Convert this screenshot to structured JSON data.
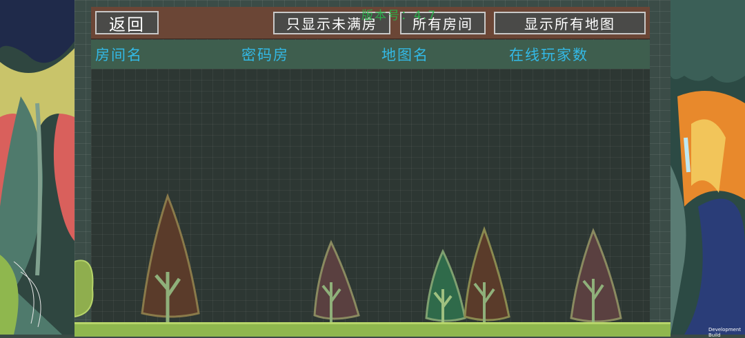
{
  "topbar": {
    "back_label": "返回",
    "filter_not_full_label": "只显示未满房",
    "all_rooms_label": "所有房间",
    "show_all_maps_label": "显示所有地图",
    "version_text": "版本号：4.7"
  },
  "table": {
    "columns": [
      "房间名",
      "密码房",
      "地图名",
      "在线玩家数"
    ],
    "rows": []
  },
  "footer": {
    "dev_build_text": "Development Build"
  },
  "colors": {
    "topbar": "#6b4636",
    "header_row": "#3e5e4e",
    "column_text": "#33b9e6",
    "version_text": "#28b84a",
    "list_background": "#2d3733"
  },
  "icons": [
    "pine-tree-icon",
    "leaf-decoration-icon"
  ]
}
